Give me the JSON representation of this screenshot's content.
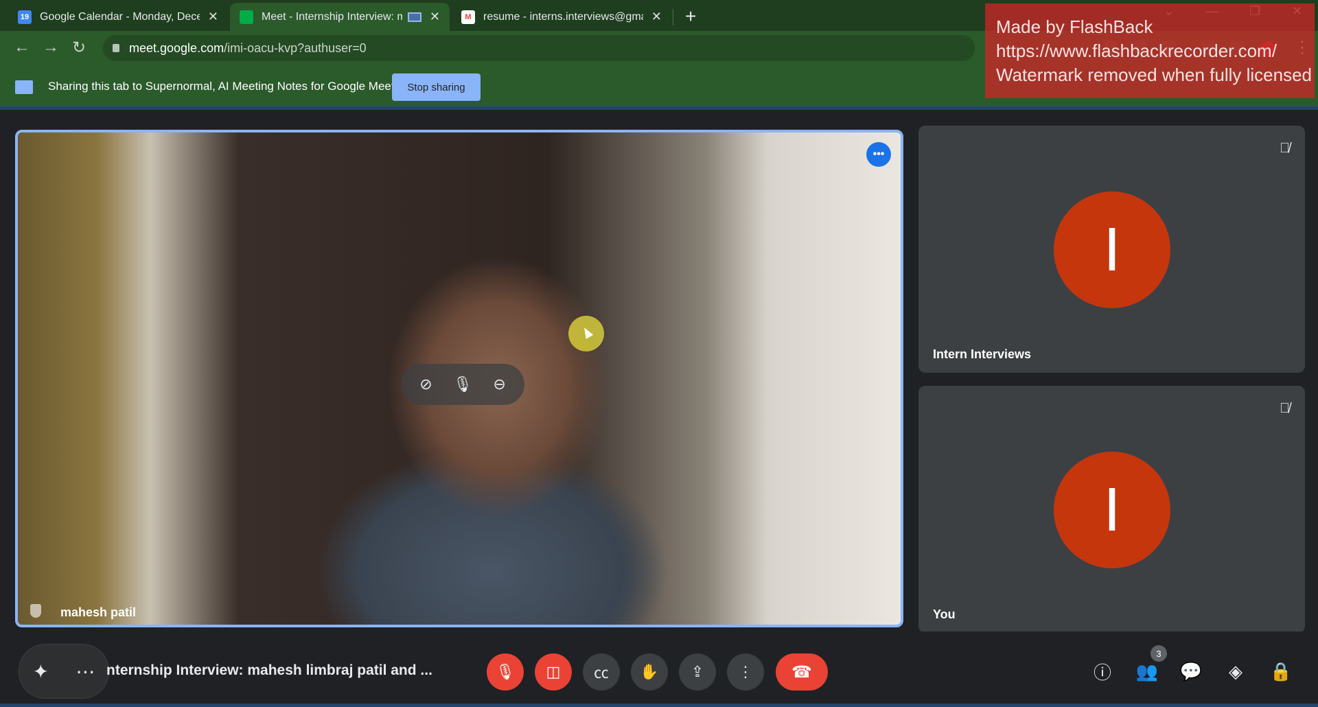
{
  "browser": {
    "tabs": [
      {
        "title": "Google Calendar - Monday, Decemb",
        "favicon": "calendar-icon",
        "favicon_text": "19",
        "active": false
      },
      {
        "title": "Meet - Internship Interview: ma",
        "favicon": "meet-icon",
        "active": true
      },
      {
        "title": "resume - interns.interviews@gmail.c",
        "favicon": "gmail-icon",
        "favicon_text": "M",
        "active": false
      }
    ],
    "new_tab": "+",
    "url_host": "meet.google.com",
    "url_path": "/imi-oacu-kvp?authuser=0"
  },
  "share_bar": {
    "text": "Sharing this tab to Supernormal, AI Meeting Notes for Google Meet",
    "stop_label": "Stop sharing"
  },
  "watermark": {
    "line1": "Made by FlashBack",
    "line2": "https://www.flashbackrecorder.com/",
    "line3": "Watermark removed when fully licensed"
  },
  "main_video": {
    "participant_name": "mahesh patil",
    "more_icon": "•••"
  },
  "tiles": [
    {
      "name": "Intern Interviews",
      "initial": "I"
    },
    {
      "name": "You",
      "initial": "I"
    }
  ],
  "bottom_bar": {
    "meeting_title": "nternship Interview: mahesh limbraj patil and ...",
    "participant_count": "3"
  },
  "colors": {
    "accent": "#8ab4f8",
    "danger": "#ea4335",
    "avatar": "#c5360d",
    "chrome_green": "#2b5a2b"
  }
}
